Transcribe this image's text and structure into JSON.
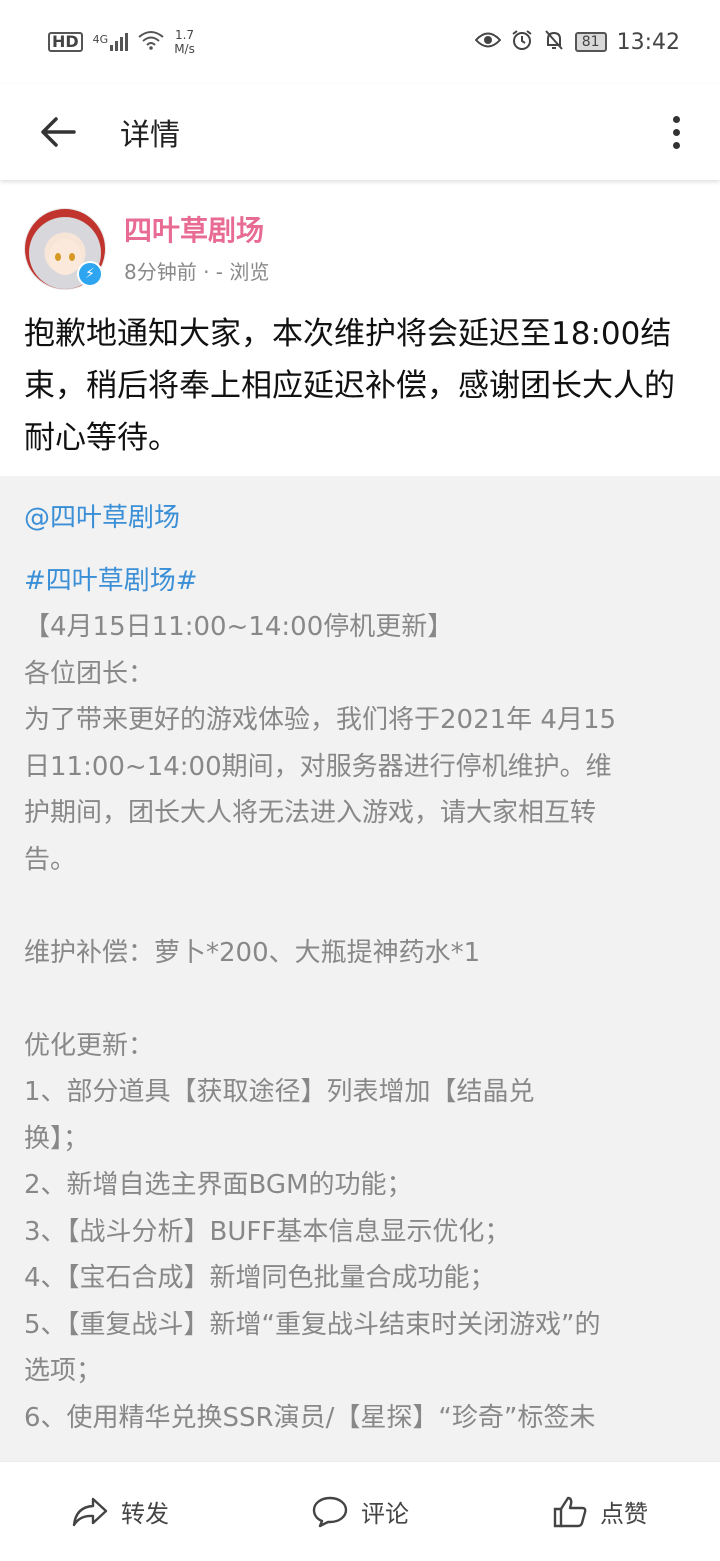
{
  "status_bar": {
    "hd": "HD",
    "signal": "4G",
    "speed_value": "1.7",
    "speed_unit": "M/s",
    "battery": "81",
    "time": "13:42",
    "icons": [
      "eye-icon",
      "alarm-icon",
      "mute-bell-icon"
    ]
  },
  "header": {
    "title": "详情"
  },
  "post": {
    "author_name": "四叶草剧场",
    "meta": "8分钟前 · - 浏览",
    "text": "抱歉地通知大家，本次维护将会延迟至18:00结束，稍后将奉上相应延迟补偿，感谢团长大人的耐心等待。"
  },
  "repost": {
    "mention": "@四叶草剧场",
    "topic": "#四叶草剧场#",
    "lines": [
      "【4月15日11:00~14:00停机更新】",
      "各位团长：",
      "为了带来更好的游戏体验，我们将于2021年 4月15",
      "日11:00~14:00期间，对服务器进行停机维护。维",
      "护期间，团长大人将无法进入游戏，请大家相互转",
      "告。",
      "",
      "维护补偿：萝卜*200、大瓶提神药水*1",
      "",
      "优化更新：",
      "1、部分道具【获取途径】列表增加【结晶兑",
      "换】；",
      "2、新增自选主界面BGM的功能；",
      "3、【战斗分析】BUFF基本信息显示优化；",
      "4、【宝石合成】新增同色批量合成功能；",
      "5、【重复战斗】新增“重复战斗结束时关闭游戏”的",
      "选项；",
      "6、使用精华兑换SSR演员/【星探】“珍奇”标签未"
    ]
  },
  "bottom_bar": {
    "repost_label": "转发",
    "comment_label": "评论",
    "like_label": "点赞"
  }
}
